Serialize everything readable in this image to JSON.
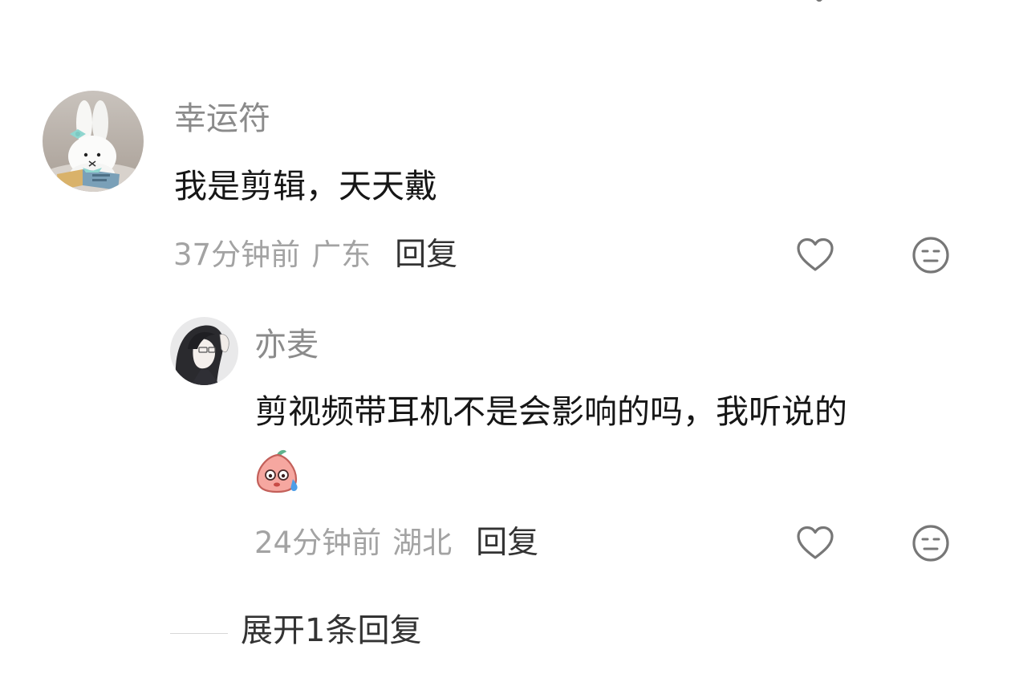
{
  "comment": {
    "username": "幸运符",
    "text": "我是剪辑，天天戴",
    "time": "37分钟前",
    "region": "广东",
    "reply_label": "回复",
    "avatar_icon": "bunny-plush-avatar"
  },
  "reply": {
    "username": "亦麦",
    "text": "剪视频带耳机不是会影响的吗，我听说的",
    "sticker_icon": "sweating-peach-sticker",
    "time": "24分钟前",
    "region": "湖北",
    "reply_label": "回复",
    "avatar_icon": "anime-glasses-avatar"
  },
  "icons": {
    "like": "heart-outline-icon",
    "emoji": "neutral-face-icon",
    "icon_color": "#777777"
  },
  "expand": {
    "label": "展开1条回复"
  }
}
